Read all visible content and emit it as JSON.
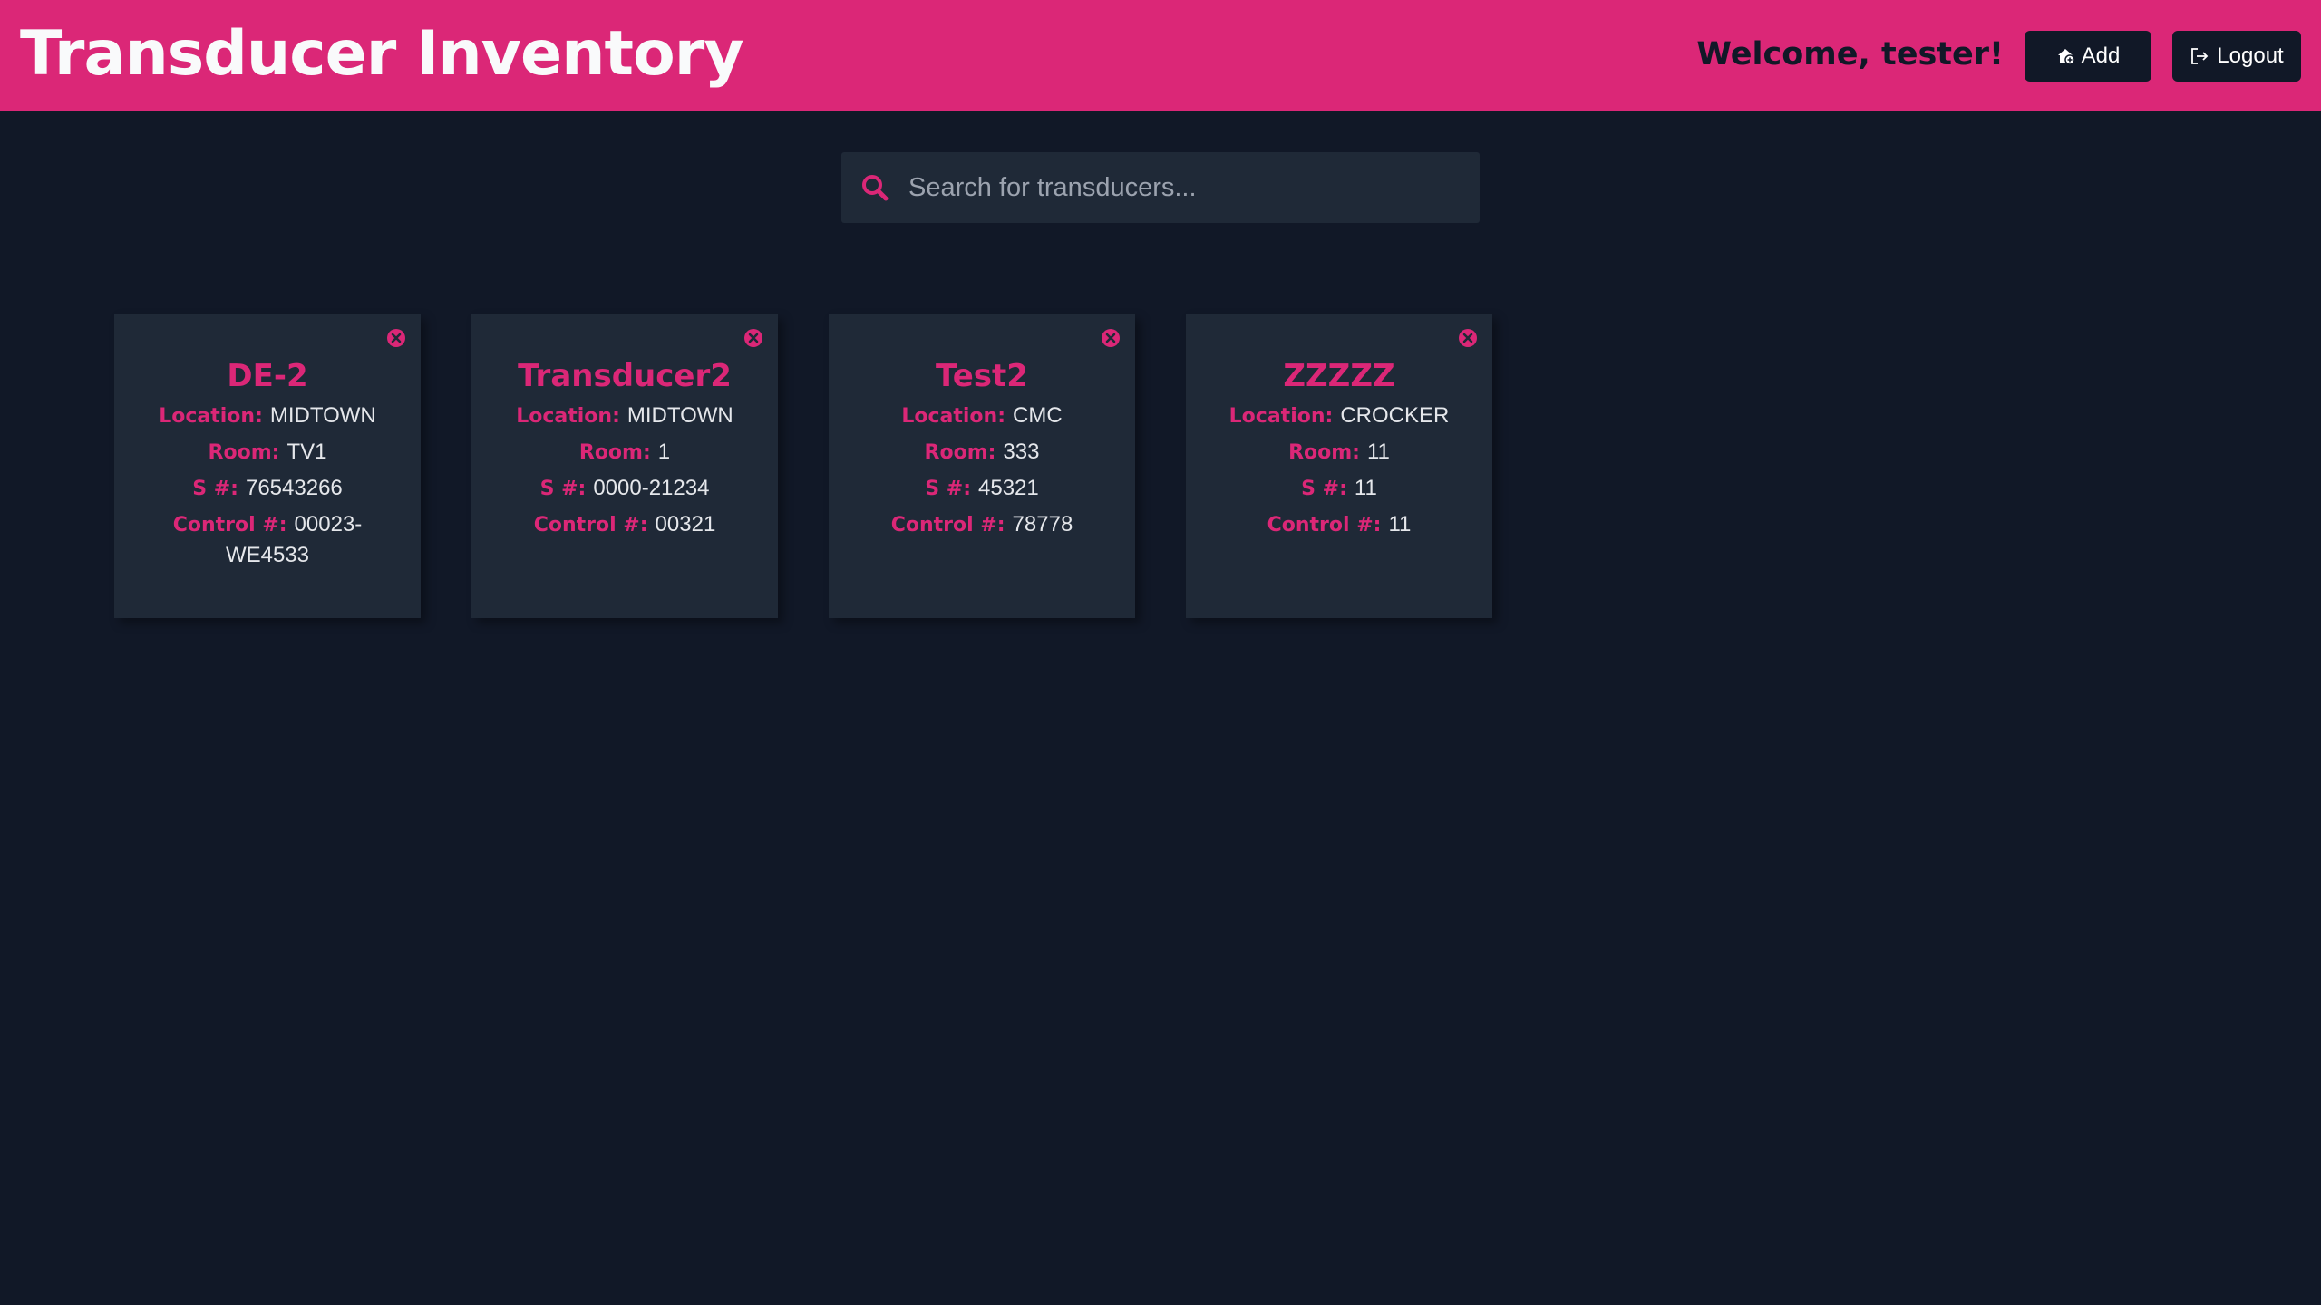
{
  "header": {
    "title": "Transducer Inventory",
    "welcome": "Welcome, tester!",
    "add_label": "Add",
    "logout_label": "Logout",
    "background_color": "#db2777"
  },
  "search": {
    "placeholder": "Search for transducers...",
    "value": ""
  },
  "labels": {
    "location": "Location:",
    "room": "Room:",
    "serial": "S #:",
    "control": "Control #:"
  },
  "cards": [
    {
      "name": "DE-2",
      "location": "MIDTOWN",
      "room": "TV1",
      "serial": "76543266",
      "control": "00023-WE4533"
    },
    {
      "name": "Transducer2",
      "location": "MIDTOWN",
      "room": "1",
      "serial": "0000-21234",
      "control": "00321"
    },
    {
      "name": "Test2",
      "location": "CMC",
      "room": "333",
      "serial": "45321",
      "control": "78778"
    },
    {
      "name": "ZZZZZ",
      "location": "CROCKER",
      "room": "11",
      "serial": "11",
      "control": "11"
    }
  ],
  "colors": {
    "accent": "#db2777",
    "page_background": "#111827",
    "card_background": "#1f2937"
  },
  "icons": {
    "search": "search-icon",
    "add": "home-plus-icon",
    "logout": "logout-icon",
    "delete": "close-circle-icon"
  }
}
